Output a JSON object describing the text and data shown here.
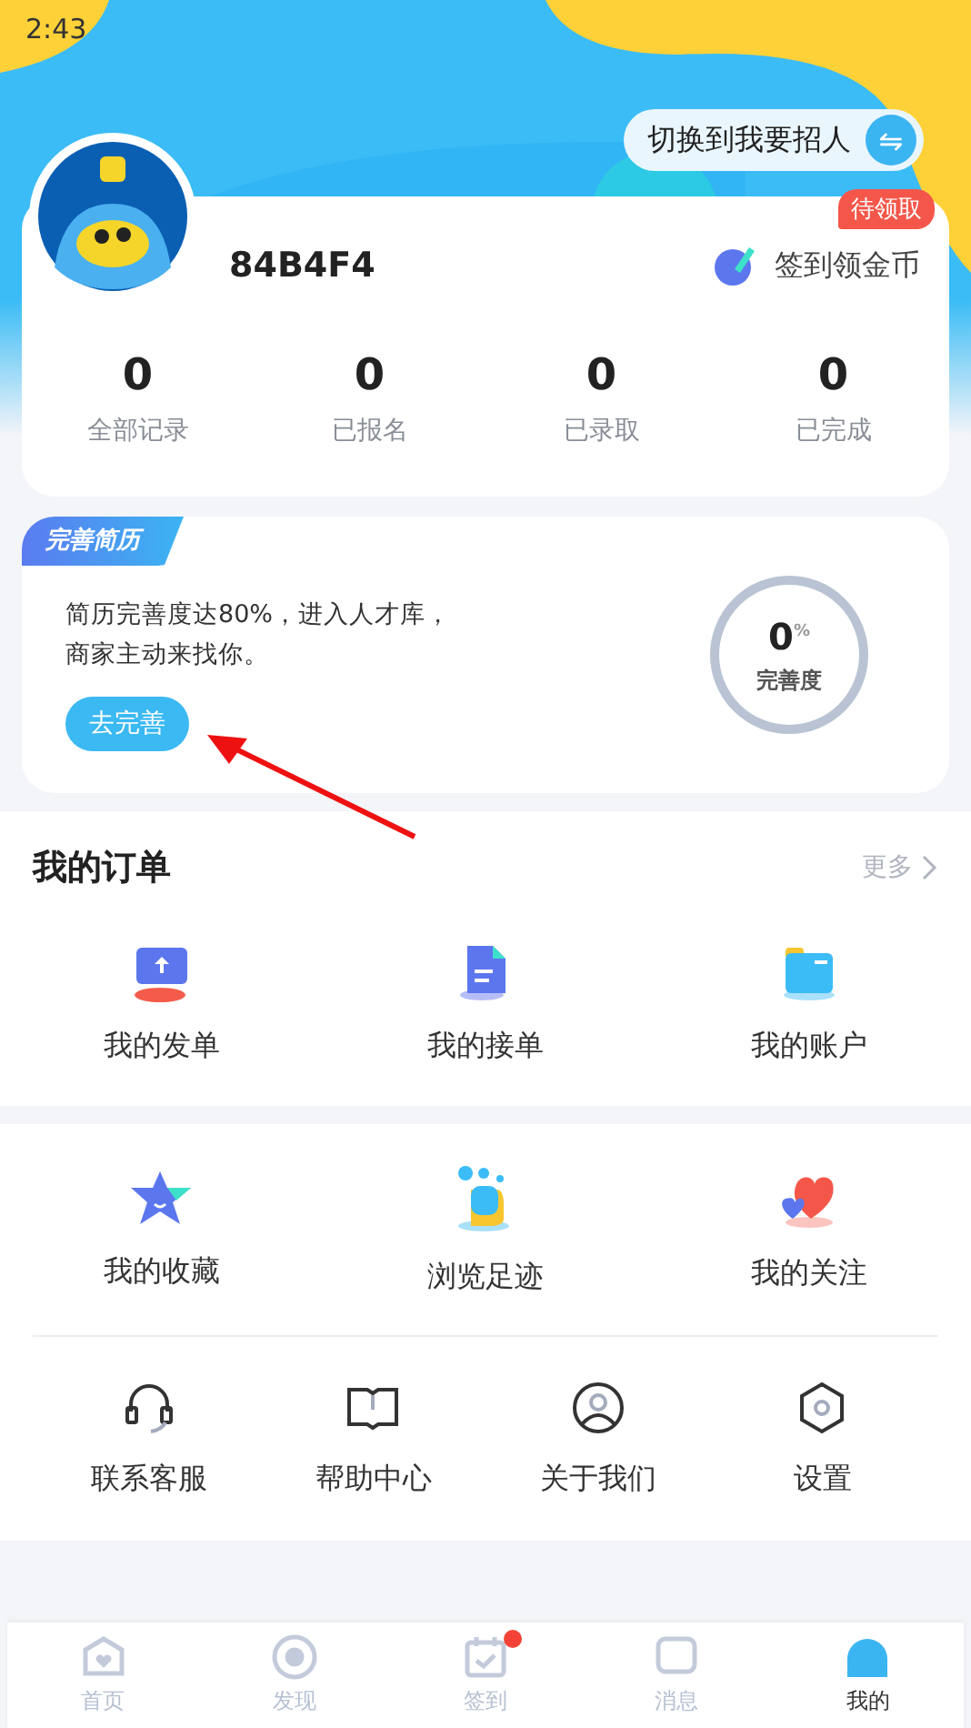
{
  "status_bar": {
    "time": "2:43"
  },
  "switch_button": {
    "label": "切换到我要招人",
    "icon": "⇋"
  },
  "profile": {
    "username": "84B4F4",
    "checkin": {
      "label": "签到领金币",
      "badge": "待领取"
    },
    "stats": [
      {
        "value": "0",
        "label": "全部记录"
      },
      {
        "value": "0",
        "label": "已报名"
      },
      {
        "value": "0",
        "label": "已录取"
      },
      {
        "value": "0",
        "label": "已完成"
      }
    ]
  },
  "resume": {
    "tag": "完善简历",
    "lines": [
      "简历完善度达80%，进入人才库，",
      "商家主动来找你。"
    ],
    "button": "去完善",
    "progress": {
      "value": "0",
      "unit": "%",
      "label": "完善度"
    }
  },
  "orders": {
    "title": "我的订单",
    "more": "更多",
    "items": [
      {
        "kind": "upload",
        "label": "我的发单"
      },
      {
        "kind": "document",
        "label": "我的接单"
      },
      {
        "kind": "folder",
        "label": "我的账户"
      }
    ]
  },
  "shortcuts": [
    {
      "kind": "star",
      "label": "我的收藏"
    },
    {
      "kind": "footprint",
      "label": "浏览足迹"
    },
    {
      "kind": "hearts",
      "label": "我的关注"
    }
  ],
  "services": [
    {
      "kind": "headset",
      "label": "联系客服"
    },
    {
      "kind": "book",
      "label": "帮助中心"
    },
    {
      "kind": "person",
      "label": "关于我们"
    },
    {
      "kind": "hexagon",
      "label": "设置"
    }
  ],
  "tab_bar": [
    {
      "kind": "home",
      "label": "首页",
      "selected": false,
      "dot": false
    },
    {
      "kind": "discover",
      "label": "发现",
      "selected": false,
      "dot": false
    },
    {
      "kind": "calendar",
      "label": "签到",
      "selected": false,
      "dot": true
    },
    {
      "kind": "message",
      "label": "消息",
      "selected": false,
      "dot": false
    },
    {
      "kind": "mine",
      "label": "我的",
      "selected": true,
      "dot": false
    }
  ]
}
